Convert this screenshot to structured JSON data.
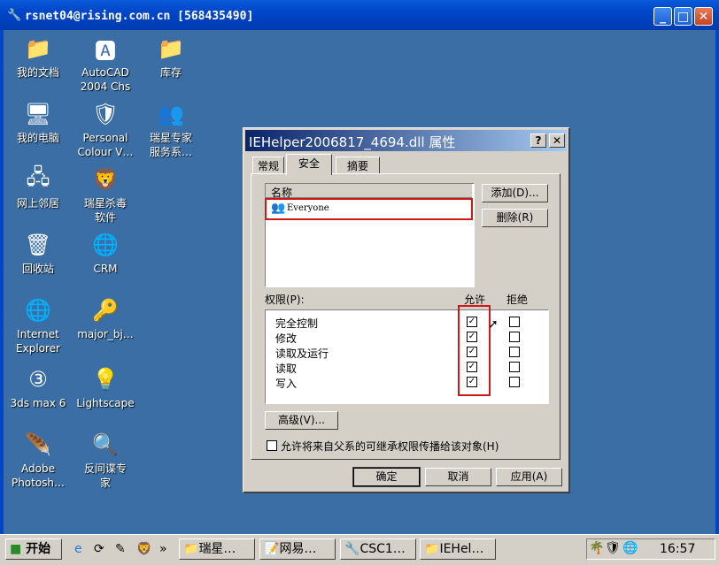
{
  "window": {
    "title": "rsnet04@rising.com.cn [568435490]",
    "buttons": {
      "min": "_",
      "max": "□",
      "close": "✕"
    }
  },
  "desktop": {
    "icons": [
      {
        "label": "我的文档",
        "glyph": "📁"
      },
      {
        "label": "AutoCAD\n2004 Chs",
        "glyph": "🅰"
      },
      {
        "label": "库存",
        "glyph": "📁"
      },
      {
        "label": "我的电脑",
        "glyph": "🖥"
      },
      {
        "label": "Personal\nColour V…",
        "glyph": "🛡"
      },
      {
        "label": "瑞星专家\n服务系…",
        "glyph": "👥"
      },
      {
        "label": "网上邻居",
        "glyph": "🖧"
      },
      {
        "label": "瑞星杀毒\n软件",
        "glyph": "🦁"
      },
      {
        "label": "回收站",
        "glyph": "🗑"
      },
      {
        "label": "CRM",
        "glyph": "🌐"
      },
      {
        "label": "Internet\nExplorer",
        "glyph": "🌐"
      },
      {
        "label": "major_bj…",
        "glyph": "🔑"
      },
      {
        "label": "3ds max 6",
        "glyph": "③"
      },
      {
        "label": "Lightscape",
        "glyph": "💡"
      },
      {
        "label": "Adobe\nPhotosh…",
        "glyph": "🪶"
      },
      {
        "label": "反间谍专\n家",
        "glyph": "🔍"
      }
    ]
  },
  "dialog": {
    "title": "IEHelper2006817_4694.dll 属性",
    "help": "?",
    "close": "✕",
    "tabs": [
      "常规",
      "安全",
      "摘要"
    ],
    "active_tab": "安全",
    "names_header": "名称",
    "names": [
      "Everyone"
    ],
    "add_button": "添加(D)...",
    "remove_button": "删除(R)",
    "perm_label": "权限(P):",
    "allow_header": "允许",
    "deny_header": "拒绝",
    "permissions": [
      {
        "name": "完全控制",
        "allow": true,
        "deny": false
      },
      {
        "name": "修改",
        "allow": true,
        "deny": false
      },
      {
        "name": "读取及运行",
        "allow": true,
        "deny": false
      },
      {
        "name": "读取",
        "allow": true,
        "deny": false
      },
      {
        "name": "写入",
        "allow": true,
        "deny": false
      }
    ],
    "advanced_button": "高级(V)...",
    "inherit_label": "允许将来自父系的可继承权限传播给该对象(H)",
    "inherit_checked": false,
    "ok": "确定",
    "cancel": "取消",
    "apply": "应用(A)"
  },
  "taskbar": {
    "start": "开始",
    "more": "»",
    "tasks": [
      "瑞星…",
      "网易…",
      "CSC1…",
      "IEHel…"
    ],
    "clock": "16:57"
  }
}
